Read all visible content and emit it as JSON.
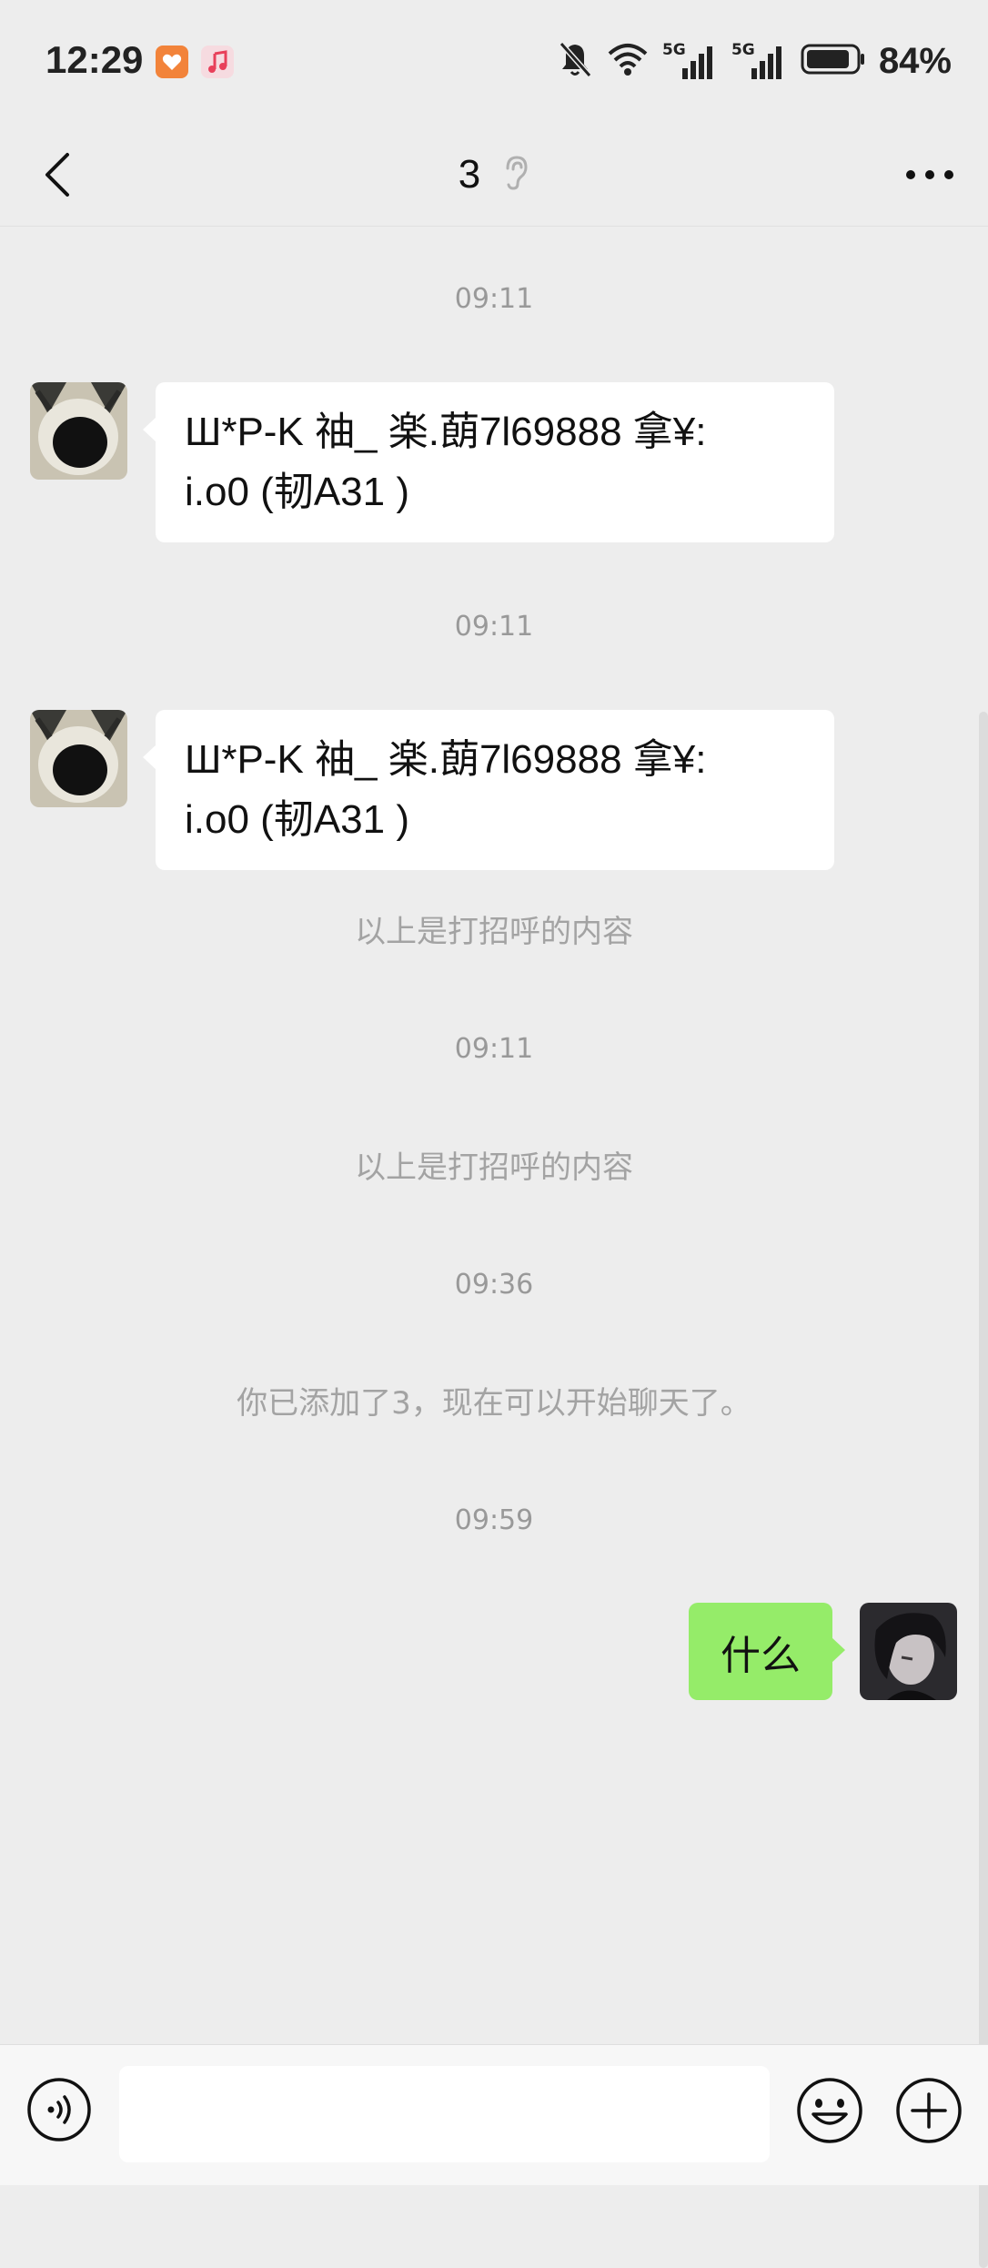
{
  "status_bar": {
    "time": "12:29",
    "battery_percent": "84%",
    "signal_1_label": "5G",
    "signal_2_label": "5G",
    "icons": [
      "app-badge-orange-icon",
      "music-app-icon",
      "bell-muted-icon",
      "wifi-icon",
      "signal-5g-icon",
      "signal-5g-icon",
      "battery-icon"
    ]
  },
  "header": {
    "title": "3",
    "back_icon": "chevron-left-icon",
    "ear_icon": "ear-icon",
    "more_icon": "more-dots-icon"
  },
  "chat": {
    "items": [
      {
        "type": "timestamp",
        "text": "09:11"
      },
      {
        "type": "incoming",
        "line1": "Ш*P-K 䄂_ 楽.蓢7l69888 拿¥:",
        "line2": "i.o0 (韧A31 )"
      },
      {
        "type": "timestamp",
        "text": "09:11"
      },
      {
        "type": "incoming",
        "line1": "Ш*P-K 䄂_ 楽.蓢7l69888 拿¥:",
        "line2": "i.o0 (韧A31 )"
      },
      {
        "type": "system",
        "text": "以上是打招呼的内容"
      },
      {
        "type": "timestamp",
        "text": "09:11"
      },
      {
        "type": "system",
        "text": "以上是打招呼的内容"
      },
      {
        "type": "timestamp",
        "text": "09:36"
      },
      {
        "type": "system",
        "text": "你已添加了3，现在可以开始聊天了。"
      },
      {
        "type": "timestamp",
        "text": "09:59"
      },
      {
        "type": "outgoing",
        "text": "什么"
      }
    ]
  },
  "input_bar": {
    "input_value": "",
    "voice_icon": "voice-icon",
    "emoji_icon": "emoji-icon",
    "plus_icon": "plus-circle-icon"
  },
  "colors": {
    "background": "#ededed",
    "bubble_incoming": "#ffffff",
    "bubble_outgoing": "#95ec69",
    "timestamp_text": "#999999",
    "system_text": "#a3a3a3",
    "input_bar_bg": "#f7f7f7"
  }
}
